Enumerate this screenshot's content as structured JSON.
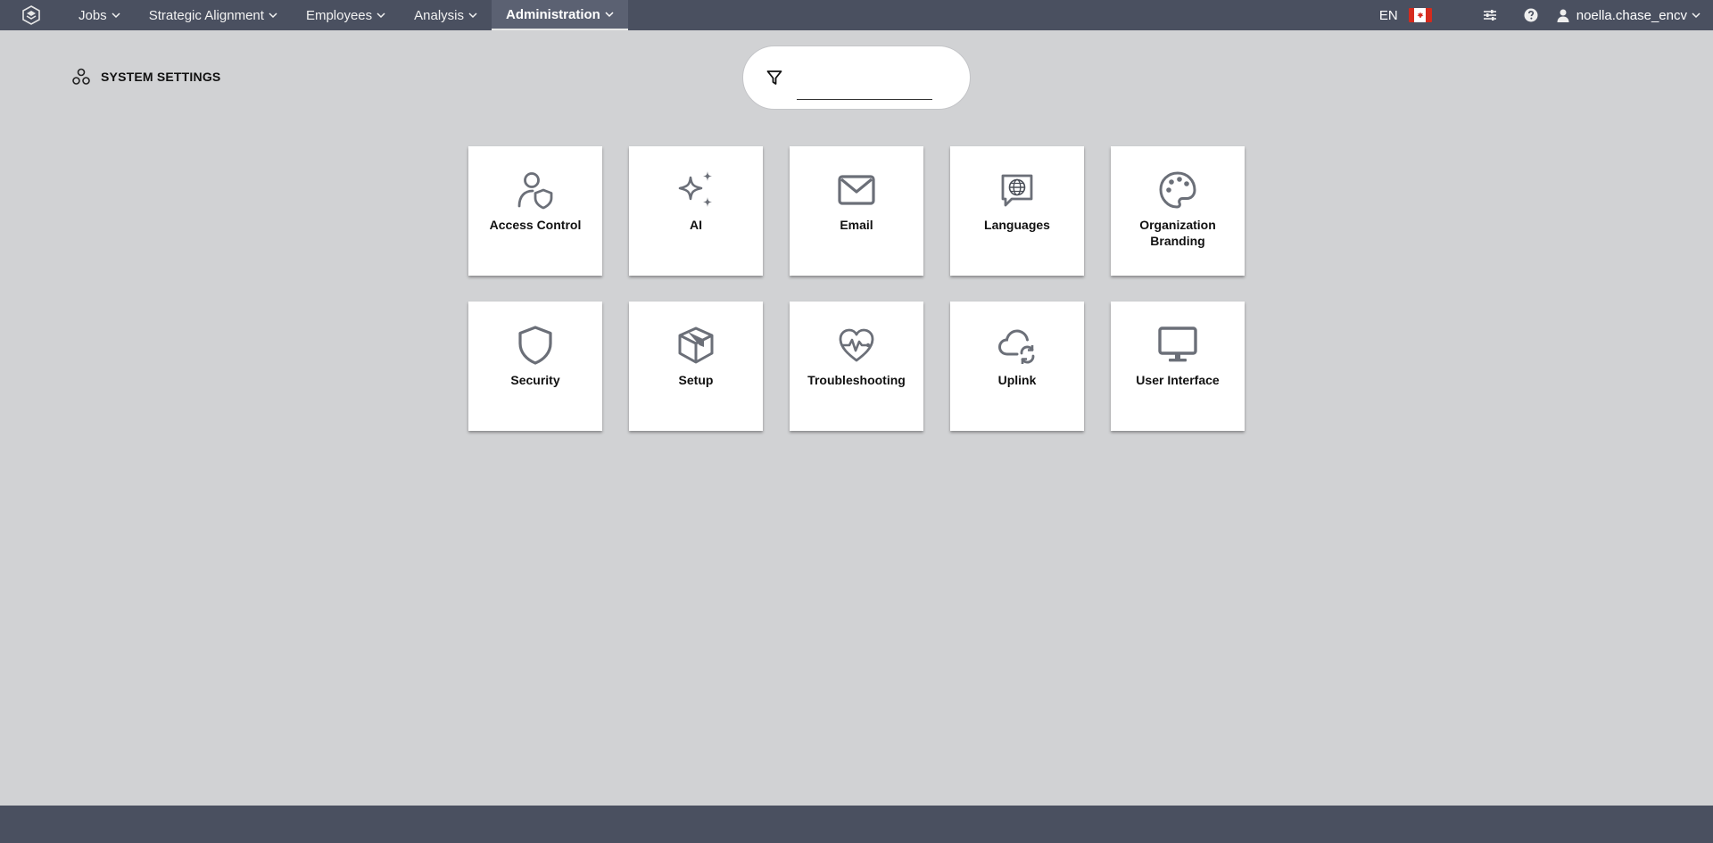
{
  "nav": {
    "items": [
      {
        "label": "Jobs",
        "active": false
      },
      {
        "label": "Strategic Alignment",
        "active": false
      },
      {
        "label": "Employees",
        "active": false
      },
      {
        "label": "Analysis",
        "active": false
      },
      {
        "label": "Administration",
        "active": true
      }
    ],
    "language": "EN",
    "username": "noella.chase_encv"
  },
  "page": {
    "heading": "SYSTEM SETTINGS"
  },
  "search": {
    "value": "",
    "placeholder": ""
  },
  "tiles": [
    {
      "label": "Access Control",
      "icon": "user-shield-icon"
    },
    {
      "label": "AI",
      "icon": "sparkles-icon"
    },
    {
      "label": "Email",
      "icon": "envelope-icon"
    },
    {
      "label": "Languages",
      "icon": "globe-chat-icon"
    },
    {
      "label": "Organization Branding",
      "icon": "palette-icon"
    },
    {
      "label": "Security",
      "icon": "shield-icon"
    },
    {
      "label": "Setup",
      "icon": "box-icon"
    },
    {
      "label": "Troubleshooting",
      "icon": "heartbeat-icon"
    },
    {
      "label": "Uplink",
      "icon": "cloud-sync-icon"
    },
    {
      "label": "User Interface",
      "icon": "monitor-icon"
    }
  ],
  "colors": {
    "nav_bg": "#4a5060",
    "page_bg": "#d1d2d4",
    "icon_gray": "#6b6f78"
  }
}
